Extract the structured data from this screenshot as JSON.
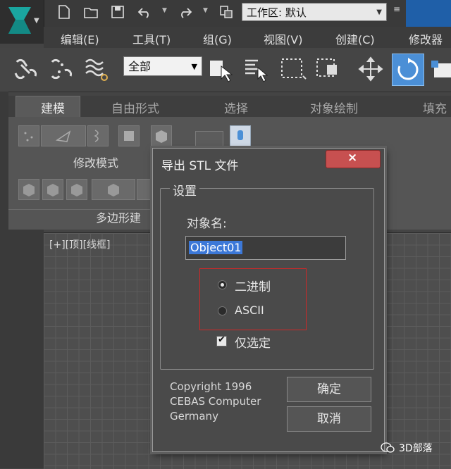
{
  "quick_access": {
    "workspace_value": "工作区: 默认"
  },
  "menu": [
    {
      "label": "编辑(E)"
    },
    {
      "label": "工具(T)"
    },
    {
      "label": "组(G)"
    },
    {
      "label": "视图(V)"
    },
    {
      "label": "创建(C)"
    },
    {
      "label": "修改器"
    }
  ],
  "toolbar": {
    "selection_filter": "全部"
  },
  "ribbon": {
    "tabs": [
      {
        "label": "建模"
      },
      {
        "label": "自由形式"
      },
      {
        "label": "选择"
      },
      {
        "label": "对象绘制"
      },
      {
        "label": "填充"
      }
    ],
    "group_modify_mode": "修改模式",
    "group_polygon": "多边形建"
  },
  "viewport": {
    "label": "[+][顶][线框]"
  },
  "dialog": {
    "title": "导出 STL 文件",
    "close_glyph": "×",
    "settings_label": "设置",
    "object_name_label": "对象名:",
    "object_name_value": "Object01",
    "format_options": [
      {
        "label": "二进制",
        "selected": true
      },
      {
        "label": "ASCII",
        "selected": false
      }
    ],
    "selected_only_label": "仅选定",
    "selected_only_checked": true,
    "checkmark": "✔",
    "copyright_lines": [
      "Copyright 1996",
      "CEBAS Computer",
      "Germany"
    ],
    "ok_label": "确定",
    "cancel_label": "取消"
  },
  "watermark": "3D部落",
  "colors": {
    "accent_blue": "#4b8fd6",
    "close_red": "#c75050",
    "highlight_box": "#d12828",
    "logo_teal": "#1aa6a0"
  }
}
